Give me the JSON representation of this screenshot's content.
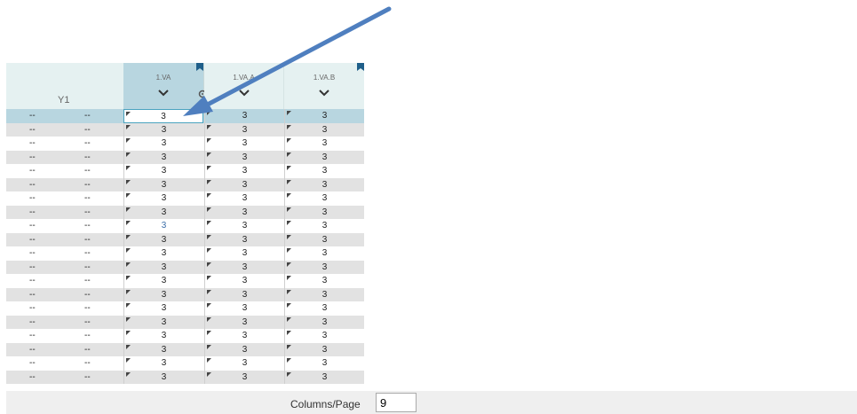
{
  "header": {
    "row_label": "Y1",
    "columns": [
      {
        "label": "1.VA"
      },
      {
        "label": "1.VA.A"
      },
      {
        "label": "1.VA.B"
      }
    ]
  },
  "rows": [
    {
      "d1": "--",
      "d2": "--",
      "v": [
        "3",
        "3",
        "3"
      ]
    },
    {
      "d1": "--",
      "d2": "--",
      "v": [
        "3",
        "3",
        "3"
      ]
    },
    {
      "d1": "--",
      "d2": "--",
      "v": [
        "3",
        "3",
        "3"
      ]
    },
    {
      "d1": "--",
      "d2": "--",
      "v": [
        "3",
        "3",
        "3"
      ]
    },
    {
      "d1": "--",
      "d2": "--",
      "v": [
        "3",
        "3",
        "3"
      ]
    },
    {
      "d1": "--",
      "d2": "--",
      "v": [
        "3",
        "3",
        "3"
      ]
    },
    {
      "d1": "--",
      "d2": "--",
      "v": [
        "3",
        "3",
        "3"
      ]
    },
    {
      "d1": "--",
      "d2": "--",
      "v": [
        "3",
        "3",
        "3"
      ]
    },
    {
      "d1": "--",
      "d2": "--",
      "v": [
        "3",
        "3",
        "3"
      ]
    },
    {
      "d1": "--",
      "d2": "--",
      "v": [
        "3",
        "3",
        "3"
      ]
    },
    {
      "d1": "--",
      "d2": "--",
      "v": [
        "3",
        "3",
        "3"
      ]
    },
    {
      "d1": "--",
      "d2": "--",
      "v": [
        "3",
        "3",
        "3"
      ]
    },
    {
      "d1": "--",
      "d2": "--",
      "v": [
        "3",
        "3",
        "3"
      ]
    },
    {
      "d1": "--",
      "d2": "--",
      "v": [
        "3",
        "3",
        "3"
      ]
    },
    {
      "d1": "--",
      "d2": "--",
      "v": [
        "3",
        "3",
        "3"
      ]
    },
    {
      "d1": "--",
      "d2": "--",
      "v": [
        "3",
        "3",
        "3"
      ]
    },
    {
      "d1": "--",
      "d2": "--",
      "v": [
        "3",
        "3",
        "3"
      ]
    },
    {
      "d1": "--",
      "d2": "--",
      "v": [
        "3",
        "3",
        "3"
      ]
    },
    {
      "d1": "--",
      "d2": "--",
      "v": [
        "3",
        "3",
        "3"
      ]
    },
    {
      "d1": "--",
      "d2": "--",
      "v": [
        "3",
        "3",
        "3"
      ]
    }
  ],
  "footer": {
    "columns_per_page_label": "Columns/Page",
    "columns_per_page_value": "9"
  },
  "colors": {
    "selected_row": "#b8d6e0",
    "header_bg": "#e5f1f1",
    "accent": "#4aa3bf",
    "arrow": "#4f7fbf"
  }
}
